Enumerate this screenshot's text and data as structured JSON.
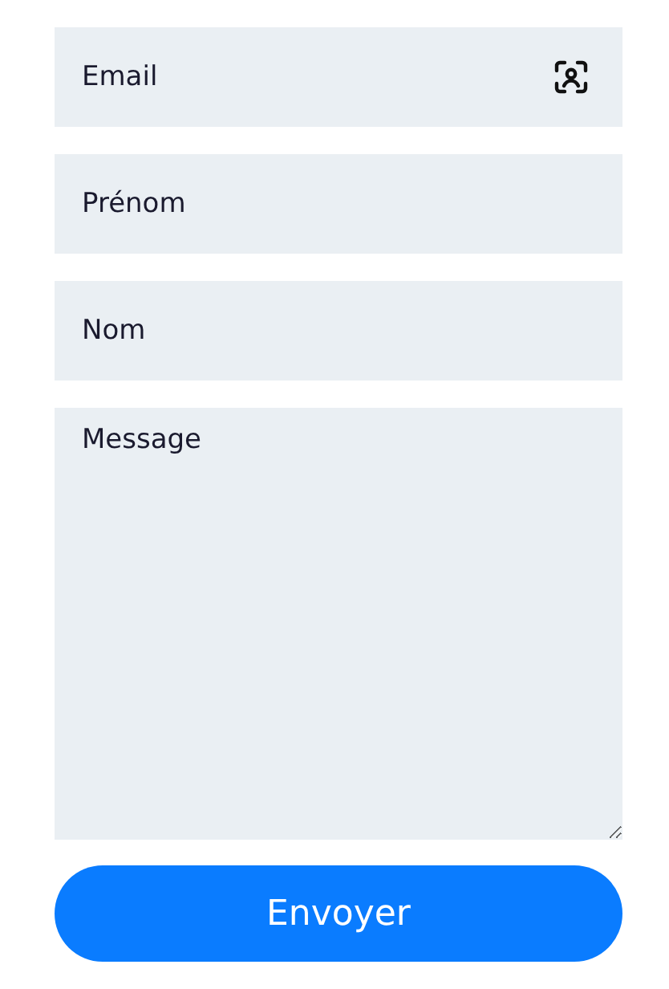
{
  "fields": [
    {
      "kind": "input_with_icon",
      "placeholder": "Email"
    },
    {
      "kind": "input",
      "placeholder": "Prénom"
    },
    {
      "kind": "input",
      "placeholder": "Nom"
    },
    {
      "kind": "textarea",
      "placeholder": "Message"
    }
  ],
  "submit": {
    "label": "Envoyer"
  }
}
